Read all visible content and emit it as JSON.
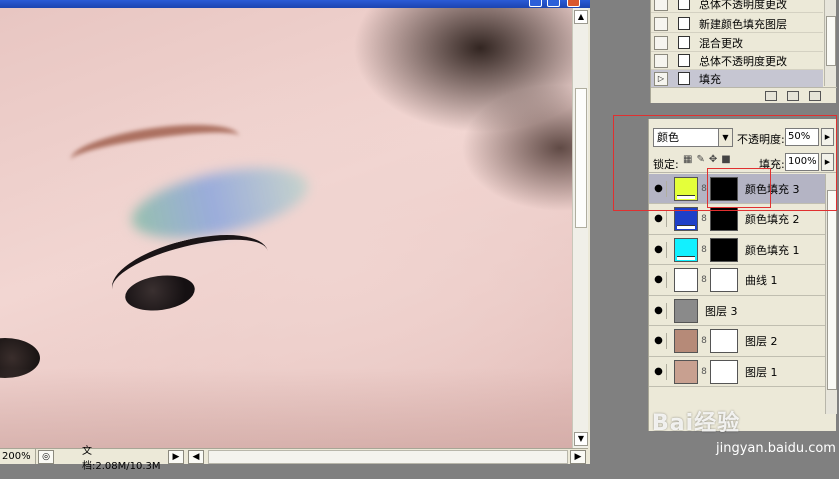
{
  "document": {
    "zoom": "200%",
    "doc_info": "文档:2.08M/10.3M"
  },
  "history": {
    "items": [
      {
        "label": "总体不透明度更改",
        "selected": false
      },
      {
        "label": "新建颜色填充图层",
        "selected": false
      },
      {
        "label": "混合更改",
        "selected": false
      },
      {
        "label": "总体不透明度更改",
        "selected": false
      },
      {
        "label": "填充",
        "selected": true
      }
    ]
  },
  "layers_panel": {
    "blend_mode": "颜色",
    "opacity_label": "不透明度:",
    "opacity_value": "50%",
    "lock_label": "锁定:",
    "fill_label": "填充:",
    "fill_value": "100%",
    "layers": [
      {
        "name": "颜色填充 3",
        "thumb_color": "#e4ff3a",
        "has_mask": true,
        "selected": true
      },
      {
        "name": "颜色填充 2",
        "thumb_color": "#1e3fc8",
        "has_mask": true,
        "selected": false
      },
      {
        "name": "颜色填充 1",
        "thumb_color": "#12f0ff",
        "has_mask": true,
        "selected": false
      },
      {
        "name": "曲线 1",
        "thumb_color": "#ffffff",
        "has_mask": true,
        "selected": false
      },
      {
        "name": "图层 3",
        "thumb_color": "#8a8a8a",
        "has_mask": false,
        "selected": false
      },
      {
        "name": "图层 2",
        "thumb_color": "#b68a78",
        "has_mask": true,
        "selected": false
      },
      {
        "name": "图层 1",
        "thumb_color": "#c8a090",
        "has_mask": true,
        "selected": false
      }
    ]
  },
  "watermark": {
    "brand": "Bai经验",
    "url": "jingyan.baidu.com"
  },
  "colors": {
    "panel_bg": "#ece9d8",
    "selected_layer": "#b4b4c4",
    "annotation_red": "#e03030"
  }
}
